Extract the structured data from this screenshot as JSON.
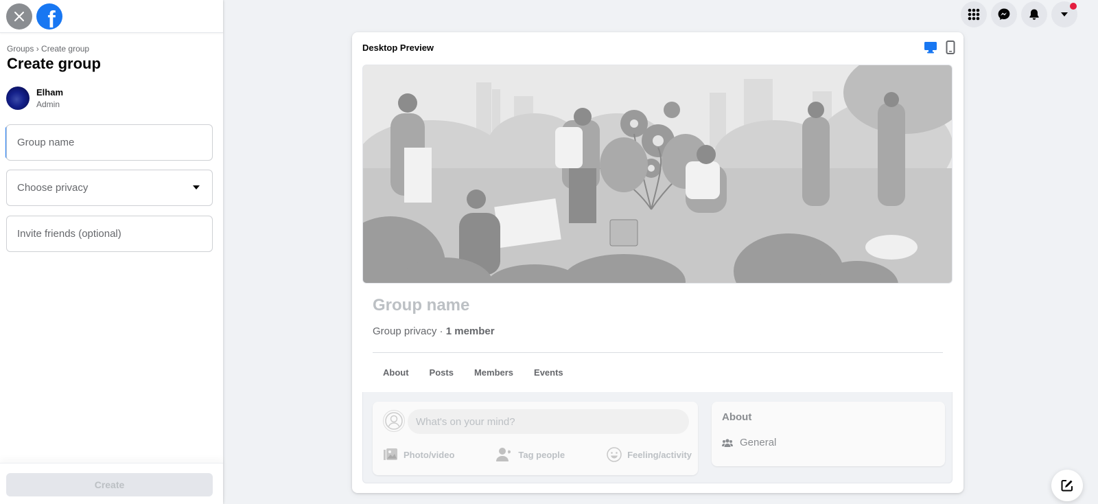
{
  "app": {
    "logo_letter": "f",
    "brand_color": "#1877f2"
  },
  "sidebar": {
    "breadcrumb": [
      "Groups",
      "Create group"
    ],
    "breadcrumb_separator": "›",
    "title": "Create group",
    "admin": {
      "name": "Elham",
      "role": "Admin"
    },
    "fields": {
      "group_name_placeholder": "Group name",
      "privacy_placeholder": "Choose privacy",
      "invite_placeholder": "Invite friends (optional)"
    },
    "create_label": "Create"
  },
  "top_icons": [
    "menu-grid-icon",
    "messenger-icon",
    "notifications-bell-icon",
    "account-caret-icon"
  ],
  "preview": {
    "title": "Desktop Preview",
    "view_modes": [
      "desktop",
      "mobile"
    ],
    "active_view": "desktop",
    "group_name": "Group name",
    "privacy_text": "Group privacy",
    "meta_separator": " · ",
    "member_count": "1 member",
    "tabs": [
      "About",
      "Posts",
      "Members",
      "Events"
    ],
    "composer": {
      "placeholder": "What's on your mind?",
      "actions": [
        "Photo/video",
        "Tag people",
        "Feeling/activity"
      ]
    },
    "about": {
      "title": "About",
      "item": "General"
    }
  }
}
